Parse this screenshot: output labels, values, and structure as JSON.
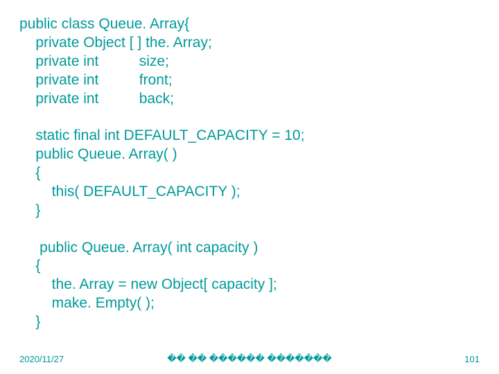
{
  "code": {
    "line1": "public class Queue. Array{",
    "line2": "    private Object [ ] the. Array;",
    "line3": "    private int          size;",
    "line4": "    private int          front;",
    "line5": "    private int          back;",
    "line6": "",
    "line7": "    static final int DEFAULT_CAPACITY = 10;",
    "line8": "    public Queue. Array( )",
    "line9": "    {",
    "line10": "        this( DEFAULT_CAPACITY );",
    "line11": "    }",
    "line12": "",
    "line13": "     public Queue. Array( int capacity )",
    "line14": "    {",
    "line15": "        the. Array = new Object[ capacity ];",
    "line16": "        make. Empty( );",
    "line17": "    }"
  },
  "footer": {
    "date": "2020/11/27",
    "center": "�� �� ������ �������",
    "page": "101"
  }
}
